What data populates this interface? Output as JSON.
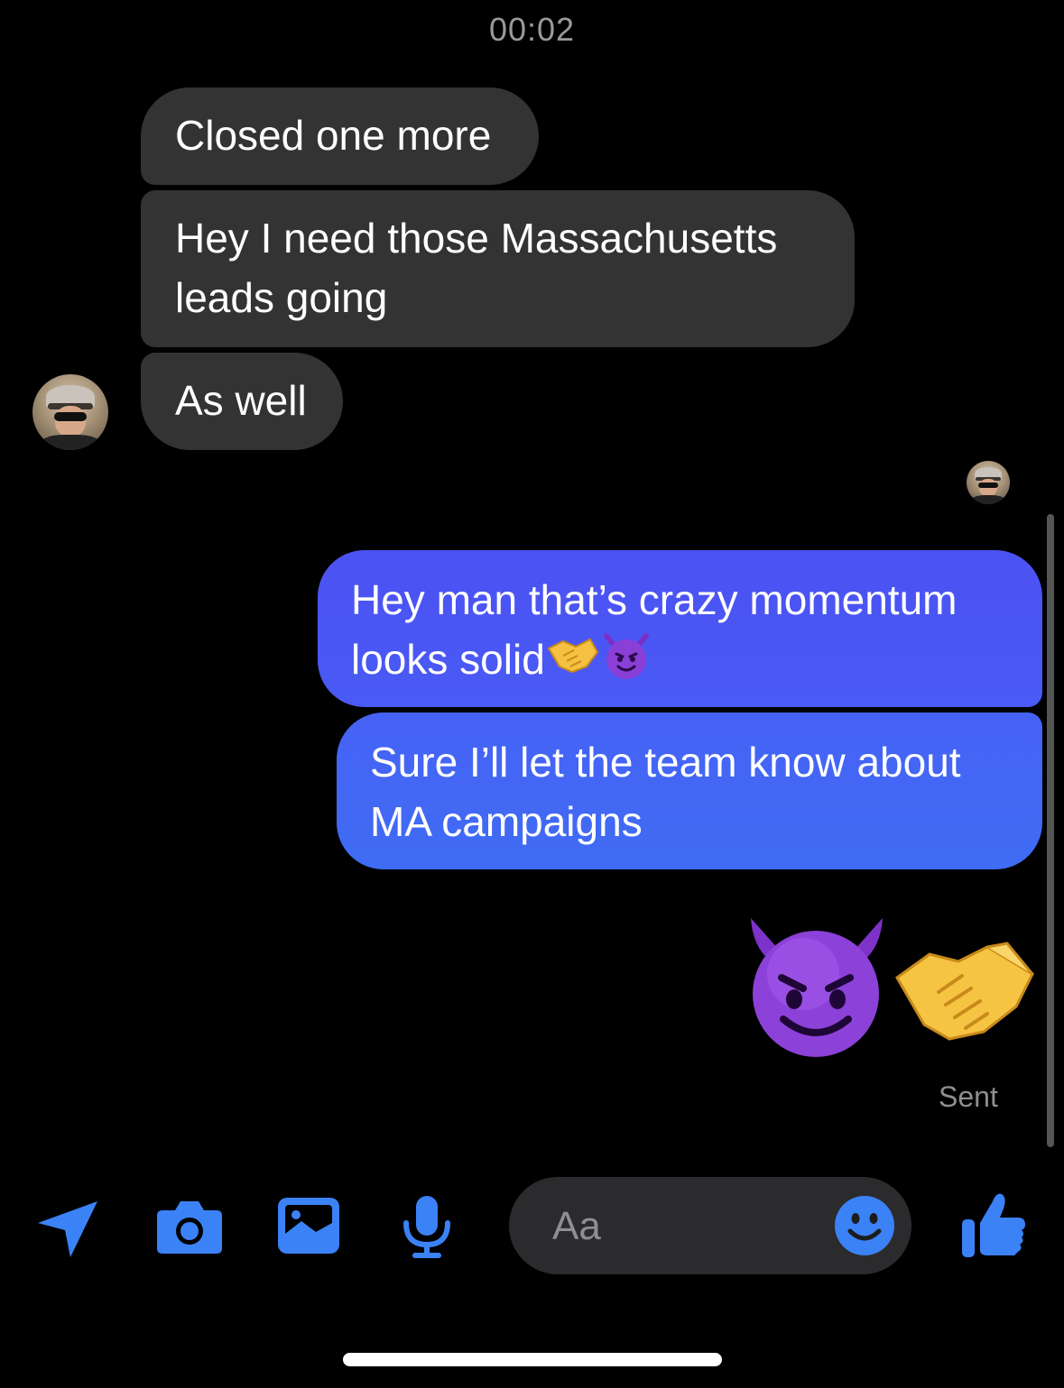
{
  "conversation": {
    "timestamp": "00:02",
    "incoming_messages": [
      {
        "text": "Closed one more"
      },
      {
        "text": "Hey I need those Massachusetts\nleads going"
      },
      {
        "text": "As well"
      }
    ],
    "outgoing_messages": [
      {
        "text_line1": "Hey man that’s crazy momentum",
        "text_line2": "looks solid",
        "emojis": [
          "handshake-emoji",
          "smiling-imp-emoji"
        ]
      },
      {
        "text": "Sure I’ll let the team know about\nMA campaigns"
      }
    ],
    "big_emojis": [
      "smiling-imp-emoji",
      "handshake-emoji"
    ],
    "status": "Sent"
  },
  "composer": {
    "placeholder": "Aa"
  },
  "toolbar": {
    "icons": [
      "location-icon",
      "camera-icon",
      "photo-icon",
      "microphone-icon",
      "emoji-icon",
      "thumbs-up-icon"
    ]
  },
  "colors": {
    "background": "#000000",
    "incoming_bubble": "#333334",
    "outgoing_bubble": "#4a5cf5",
    "accent": "#3b82f6",
    "secondary_text": "#8e8e93"
  }
}
